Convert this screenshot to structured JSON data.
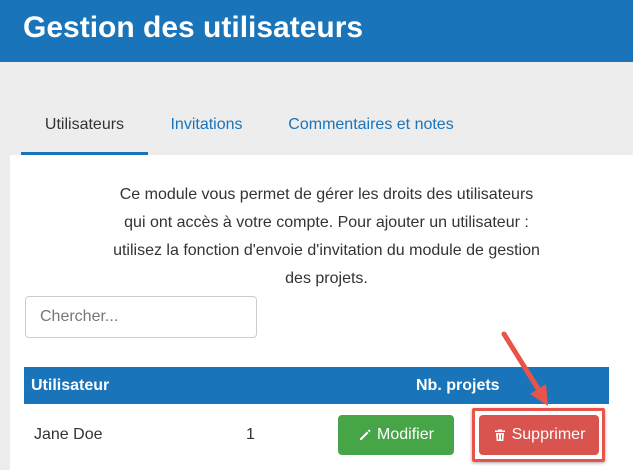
{
  "header": {
    "title": "Gestion des utilisateurs"
  },
  "tabs": [
    {
      "label": "Utilisateurs",
      "active": true
    },
    {
      "label": "Invitations",
      "active": false
    },
    {
      "label": "Commentaires et notes",
      "active": false
    }
  ],
  "intro": {
    "lines": [
      "Ce module vous permet de gérer les droits des utilisateurs",
      "qui ont accès à votre compte. Pour ajouter un utilisateur :",
      "utilisez la fonction d'envoie d'invitation du module de gestion",
      "des projets."
    ]
  },
  "search": {
    "placeholder": "Chercher..."
  },
  "table": {
    "headers": {
      "user": "Utilisateur",
      "projects": "Nb. projets"
    },
    "rows": [
      {
        "name": "Jane Doe",
        "projects": "1",
        "edit_label": "Modifier",
        "delete_label": "Supprimer"
      }
    ]
  },
  "icons": {
    "edit": "pencil-icon",
    "delete": "trash-icon"
  },
  "colors": {
    "brand": "#1a74b9",
    "success": "#46a546",
    "danger": "#d9534f",
    "annotation": "#e8534a"
  }
}
